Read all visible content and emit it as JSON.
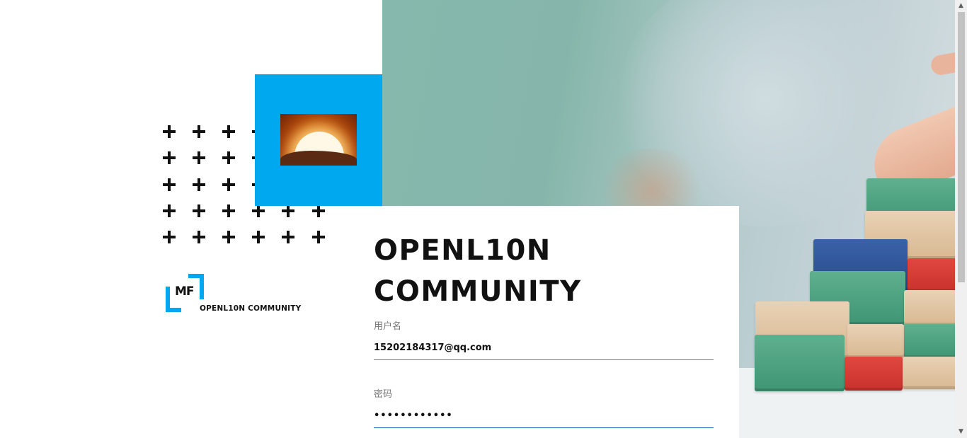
{
  "brand": {
    "title_line1": "OPENL10N",
    "title_line2": "COMMUNITY",
    "logo_text": "MF",
    "logo_caption": "OPENL10N COMMUNITY"
  },
  "login": {
    "username_label": "用户名",
    "username_value": "15202184317@qq.com",
    "password_label": "密码",
    "password_value": "••••••••••••"
  },
  "icons": {
    "sun_logo": "sunrise-image",
    "pattern": "plus-pattern",
    "scroll_up": "▲",
    "scroll_down": "▼"
  },
  "colors": {
    "accent_blue": "#00a8f0",
    "input_focus": "#1f68c8"
  }
}
